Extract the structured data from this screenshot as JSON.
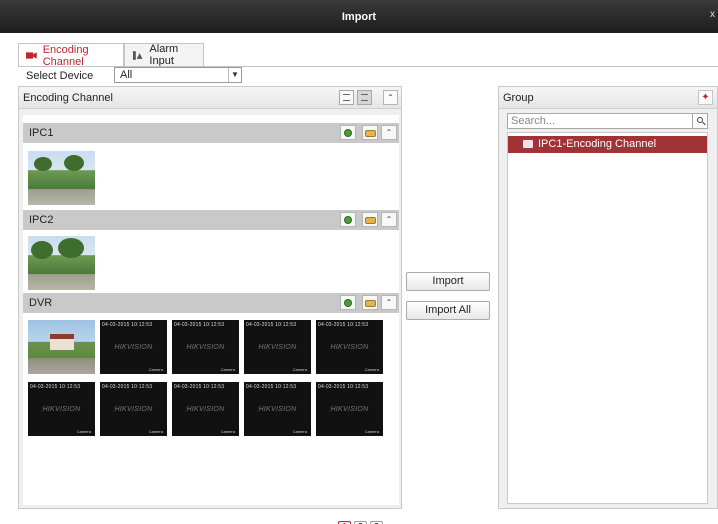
{
  "window": {
    "title": "Import",
    "close": "x"
  },
  "tabs": [
    {
      "label": "Encoding Channel",
      "icon": "camera-icon",
      "active": true
    },
    {
      "label": "Alarm Input",
      "icon": "alarm-input-icon",
      "active": false
    }
  ],
  "select_device": {
    "label": "Select Device",
    "value": "All"
  },
  "left_panel": {
    "title": "Encoding Channel",
    "groups": [
      {
        "name": "IPC1",
        "thumbnails": [
          "photo"
        ]
      },
      {
        "name": "IPC2",
        "thumbnails": [
          "photo"
        ]
      },
      {
        "name": "DVR",
        "thumbnails": [
          "photo",
          "cam",
          "cam",
          "cam",
          "cam",
          "cam",
          "cam",
          "cam",
          "cam",
          "cam"
        ]
      }
    ],
    "cam_overlay": {
      "timestamp": "04-03-2015 10:12:53",
      "watermark": "HIKVISION",
      "channel": "Camera"
    },
    "pages": [
      "1",
      "2",
      "3"
    ],
    "current_page": "1"
  },
  "actions": {
    "import": "Import",
    "import_all": "Import All"
  },
  "right_panel": {
    "title": "Group",
    "search_placeholder": "Search...",
    "tree": [
      {
        "label": "IPC1-Encoding Channel",
        "selected": true
      }
    ]
  },
  "colors": {
    "accent": "#c0262c",
    "selected_row": "#a13236",
    "titlebar": "#1d1d1d"
  }
}
